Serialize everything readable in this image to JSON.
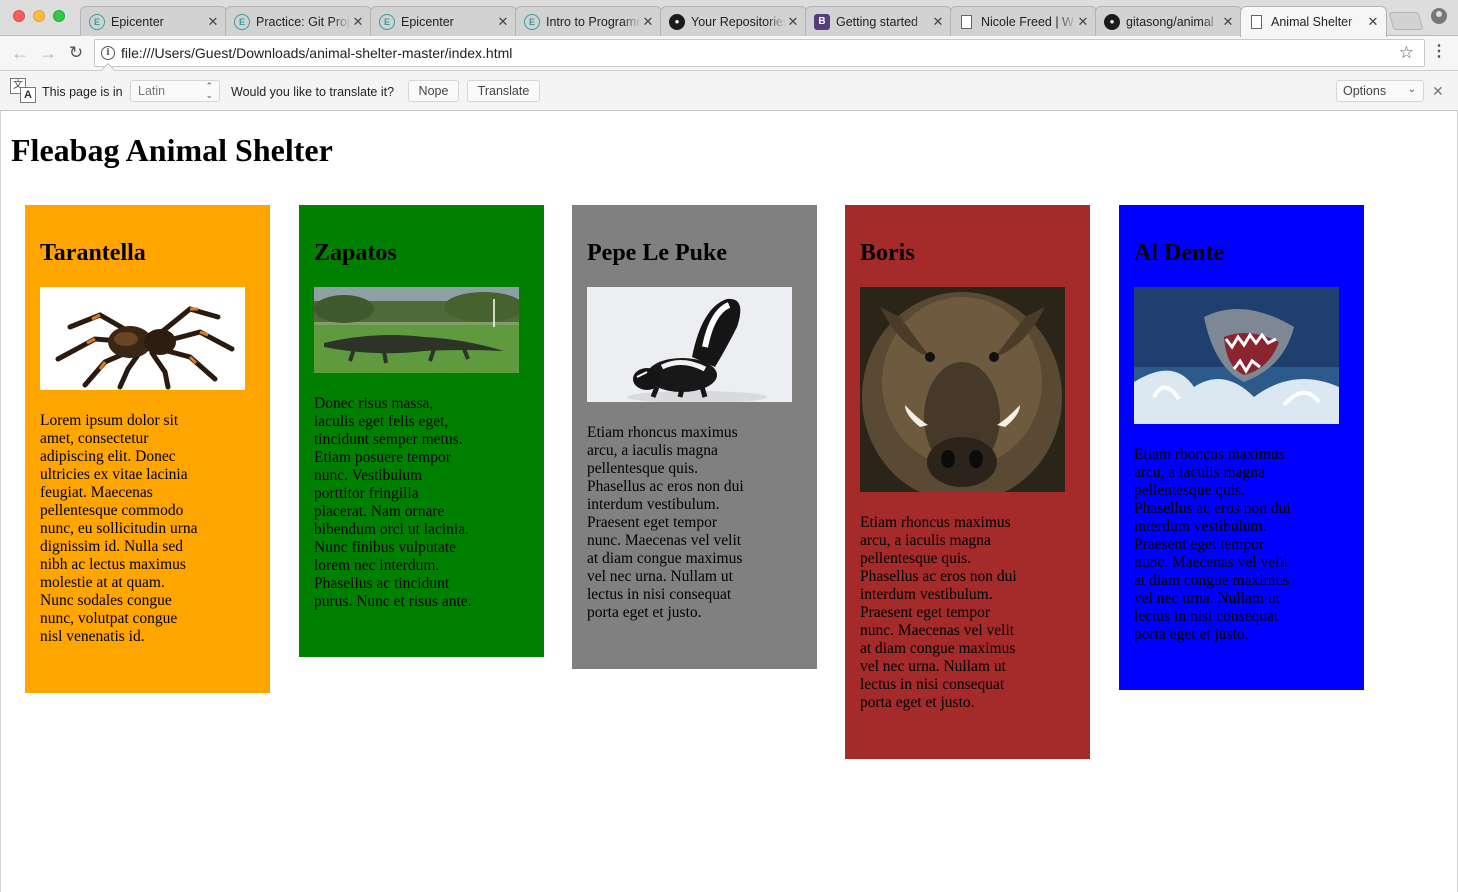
{
  "tabs": [
    {
      "label": "Epicenter",
      "favicon": "epicenter-icon"
    },
    {
      "label": "Practice: Git Project",
      "favicon": "epicenter-icon"
    },
    {
      "label": "Epicenter",
      "favicon": "epicenter-icon"
    },
    {
      "label": "Intro to Programming",
      "favicon": "epicenter-icon"
    },
    {
      "label": "Your Repositories",
      "favicon": "github-icon"
    },
    {
      "label": "Getting started",
      "favicon": "bootstrap-icon"
    },
    {
      "label": "Nicole Freed | W",
      "favicon": "page-icon"
    },
    {
      "label": "gitasong/animal",
      "favicon": "github-icon"
    },
    {
      "label": "Animal Shelter",
      "favicon": "page-icon"
    }
  ],
  "address_bar": {
    "url": "file:///Users/Guest/Downloads/animal-shelter-master/index.html"
  },
  "translate_bar": {
    "prefix": "This page is in",
    "language": "Latin",
    "question": "Would you like to translate it?",
    "nope_label": "Nope",
    "translate_label": "Translate",
    "options_label": "Options"
  },
  "page": {
    "title": "Fleabag Animal Shelter",
    "animals": [
      {
        "name": "Tarantella",
        "bg_color": "#ffa500",
        "photo": "tarantula-photo",
        "description": "Lorem ipsum dolor sit amet, consectetur adipiscing elit. Donec ultricies ex vitae lacinia feugiat. Maecenas pellentesque commodo nunc, eu sollicitudin urna dignissim id. Nulla sed nibh ac lectus maximus molestie at at quam. Nunc sodales congue nunc, volutpat congue nisl venenatis id."
      },
      {
        "name": "Zapatos",
        "bg_color": "#008000",
        "photo": "alligator-photo",
        "description": "Donec risus massa, iaculis eget felis eget, tincidunt semper metus. Etiam posuere tempor nunc. Vestibulum porttitor fringilla placerat. Nam ornare bibendum orci ut lacinia. Nunc finibus vulputate lorem nec interdum. Phasellus ac tincidunt purus. Nunc et risus ante."
      },
      {
        "name": "Pepe Le Puke",
        "bg_color": "#808080",
        "photo": "skunk-photo",
        "description": "Etiam rhoncus maximus arcu, a iaculis magna pellentesque quis. Phasellus ac eros non dui interdum vestibulum. Praesent eget tempor nunc. Maecenas vel velit at diam congue maximus vel nec urna. Nullam ut lectus in nisi consequat porta eget et justo."
      },
      {
        "name": "Boris",
        "bg_color": "#a52a2a",
        "photo": "boar-photo",
        "description": "Etiam rhoncus maximus arcu, a iaculis magna pellentesque quis. Phasellus ac eros non dui interdum vestibulum. Praesent eget tempor nunc. Maecenas vel velit at diam congue maximus vel nec urna. Nullam ut lectus in nisi consequat porta eget et justo."
      },
      {
        "name": "Al Dente",
        "bg_color": "#0000ff",
        "photo": "shark-photo",
        "description": "Etiam rhoncus maximus arcu, a iaculis magna pellentesque quis. Phasellus ac eros non dui interdum vestibulum. Praesent eget tempor nunc. Maecenas vel velit at diam congue maximus vel nec urna. Nullam ut lectus in nisi consequat porta eget et justo."
      }
    ]
  }
}
